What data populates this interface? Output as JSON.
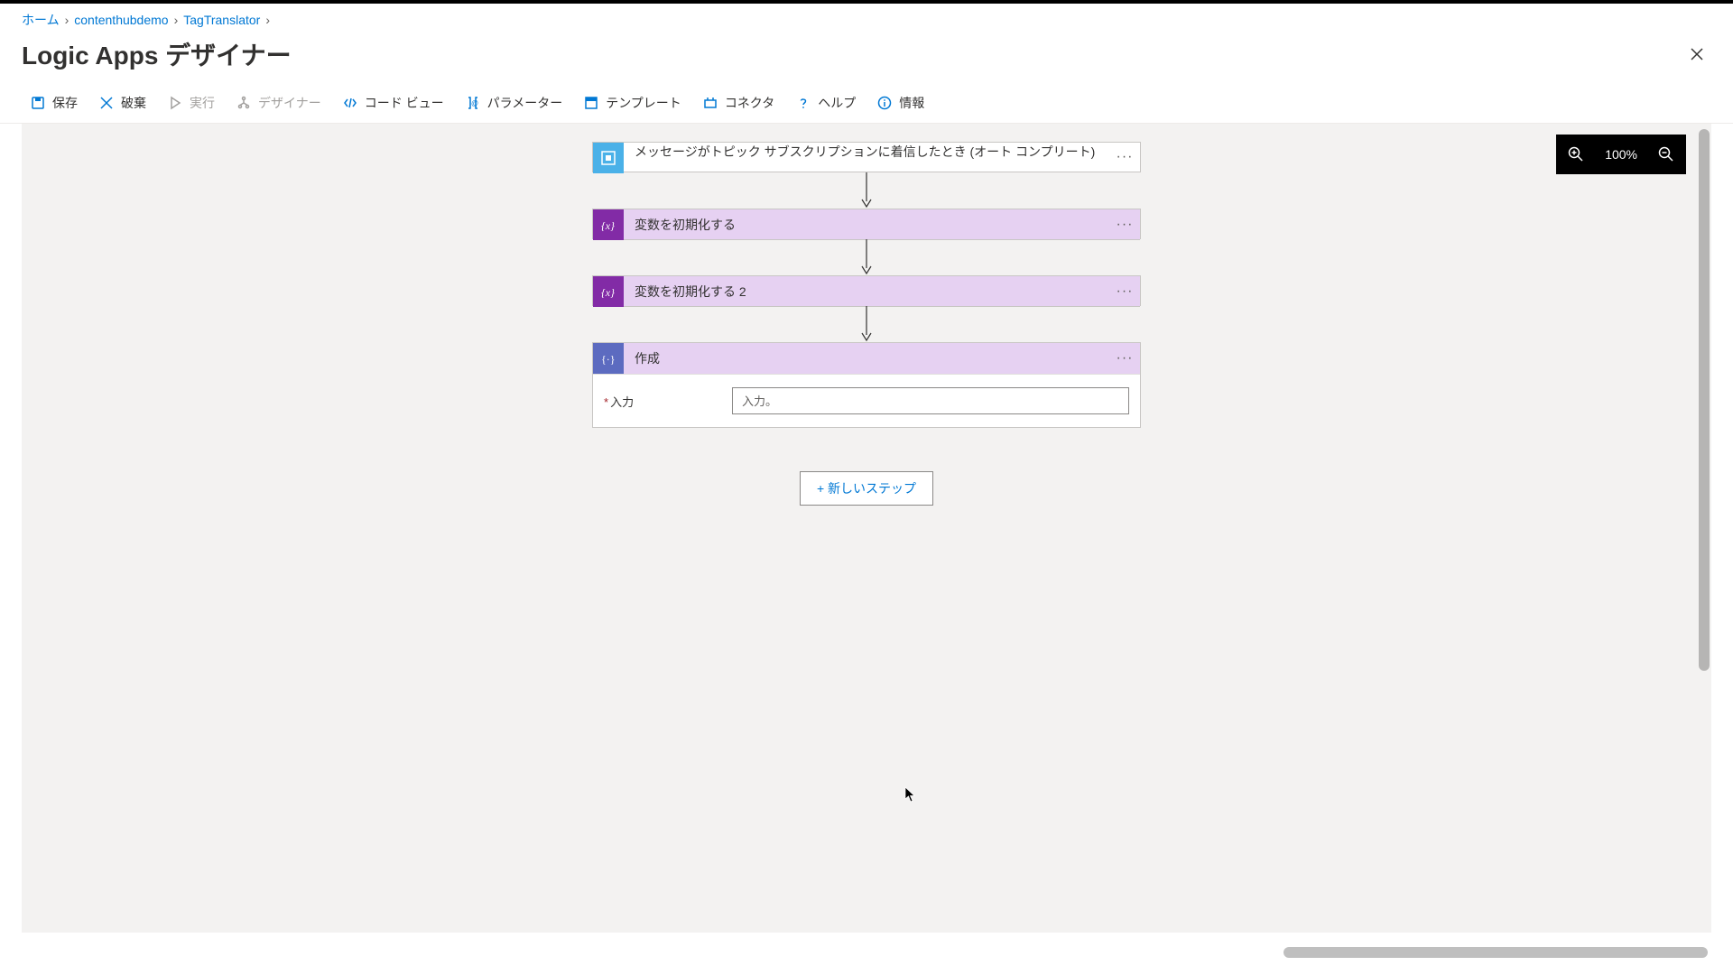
{
  "breadcrumb": {
    "home": "ホーム",
    "level1": "contenthubdemo",
    "level2": "TagTranslator"
  },
  "page_title": "Logic Apps デザイナー",
  "toolbar": {
    "save": "保存",
    "discard": "破棄",
    "run": "実行",
    "designer": "デザイナー",
    "code_view": "コード ビュー",
    "parameters": "パラメーター",
    "templates": "テンプレート",
    "connectors": "コネクタ",
    "help": "ヘルプ",
    "info": "情報"
  },
  "zoom": {
    "level": "100%"
  },
  "flow": {
    "trigger": {
      "title": "メッセージがトピック サブスクリプションに着信したとき (オート コンプリート)"
    },
    "steps": [
      {
        "title": "変数を初期化する"
      },
      {
        "title": "変数を初期化する 2"
      }
    ],
    "compose": {
      "title": "作成",
      "input_label": "入力",
      "input_placeholder": "入力。"
    },
    "new_step_label": "+ 新しいステップ"
  },
  "menu_dots": "···"
}
